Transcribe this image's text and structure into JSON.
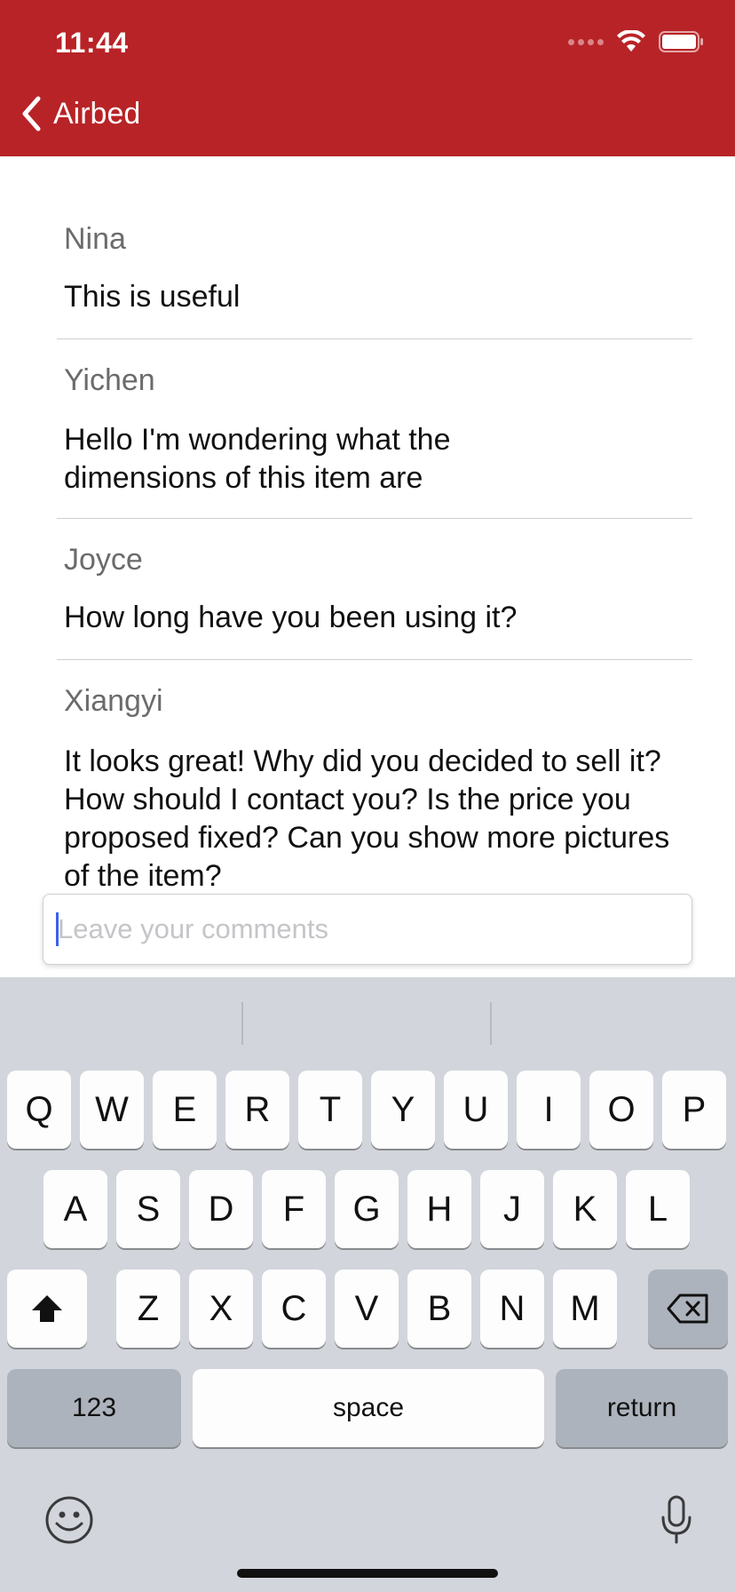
{
  "status_bar": {
    "time": "11:44"
  },
  "nav": {
    "back_label": "Airbed"
  },
  "comments": [
    {
      "author": "Nina",
      "text": "This is useful"
    },
    {
      "author": "Yichen",
      "text": "Hello I'm wondering what the dimensions of this item are"
    },
    {
      "author": "Joyce",
      "text": "How long have you been using it?"
    },
    {
      "author": "Xiangyi",
      "text": "It looks great! Why did you decided to sell it? How should I contact you? Is the price you proposed fixed? Can you show more pictures of the item?"
    }
  ],
  "comment_input": {
    "placeholder": "Leave your comments",
    "value": ""
  },
  "keyboard": {
    "row1": [
      "Q",
      "W",
      "E",
      "R",
      "T",
      "Y",
      "U",
      "I",
      "O",
      "P"
    ],
    "row2": [
      "A",
      "S",
      "D",
      "F",
      "G",
      "H",
      "J",
      "K",
      "L"
    ],
    "row3": [
      "Z",
      "X",
      "C",
      "V",
      "B",
      "N",
      "M"
    ],
    "numbers_label": "123",
    "space_label": "space",
    "return_label": "return"
  },
  "icons": {
    "back": "chevron-left-icon",
    "wifi": "wifi-icon",
    "battery": "battery-icon",
    "shift": "shift-icon",
    "delete": "delete-icon",
    "emoji": "emoji-icon",
    "mic": "microphone-icon"
  },
  "colors": {
    "header": "#b82327",
    "keyboard": "#d2d5db",
    "cursor": "#3b62e8"
  }
}
